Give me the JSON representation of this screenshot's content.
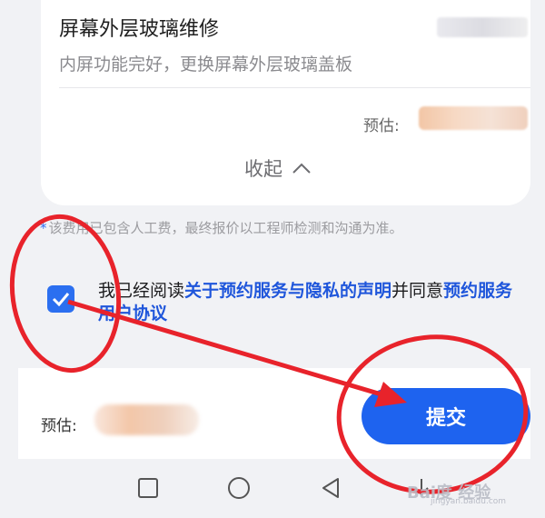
{
  "card": {
    "service_title": "屏幕外层玻璃维修",
    "service_desc": "内屏功能完好，更换屏幕外层玻璃盖板",
    "estimate_label": "预估:",
    "collapse_label": "收起"
  },
  "note": {
    "star": "*",
    "text": "该费用已包含人工费，最终报价以工程师检测和沟通为准。"
  },
  "agreement": {
    "checked": true,
    "prefix": "我已经阅读",
    "link_privacy": "关于预约服务与隐私的声明",
    "middle": "并同意",
    "link_terms": "预约服务用户协议"
  },
  "bottom_bar": {
    "estimate_label": "预估:",
    "submit_label": "提交"
  },
  "watermark": {
    "text": "Bai度 经验",
    "sub": "jingyan.baidu.com"
  },
  "colors": {
    "accent": "#1e63ef",
    "link": "#1f56db",
    "annotation_red": "#e8232b"
  },
  "icons": {
    "collapse": "chevron-up-icon",
    "checkbox": "check-icon",
    "nav_recent": "square-icon",
    "nav_home": "circle-icon",
    "nav_back": "triangle-back-icon",
    "nav_download": "arrow-down-icon"
  }
}
